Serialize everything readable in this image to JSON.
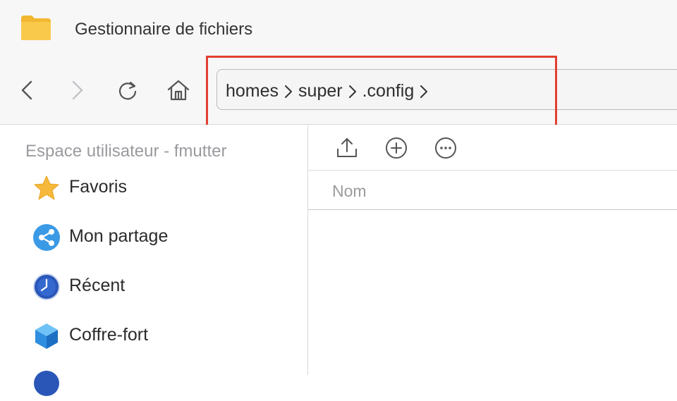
{
  "window": {
    "title": "Gestionnaire de fichiers",
    "icon": "folder-icon"
  },
  "toolbar": {
    "back_icon": "chevron-left-icon",
    "forward_icon": "chevron-right-icon",
    "refresh_icon": "refresh-icon",
    "home_icon": "home-icon"
  },
  "path": {
    "segments": [
      "homes",
      "super",
      ".config"
    ],
    "separator_icon": "chevron-right-icon"
  },
  "sidebar": {
    "header": "Espace utilisateur - fmutter",
    "items": [
      {
        "label": "Favoris",
        "icon": "star-icon"
      },
      {
        "label": "Mon partage",
        "icon": "share-icon"
      },
      {
        "label": "Récent",
        "icon": "clock-icon"
      },
      {
        "label": "Coffre-fort",
        "icon": "cube-icon"
      }
    ]
  },
  "main": {
    "actions": [
      "upload-icon",
      "add-icon",
      "more-icon"
    ],
    "columns": [
      "Nom"
    ]
  },
  "colors": {
    "highlight": "#e2402f",
    "folder": "#f6c343"
  }
}
